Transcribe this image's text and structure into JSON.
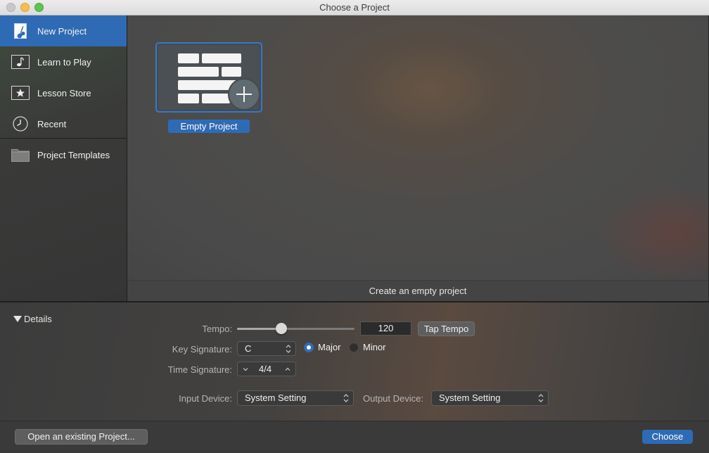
{
  "window": {
    "title": "Choose a Project"
  },
  "sidebar": {
    "items": [
      {
        "label": "New Project",
        "icon": "guitar-document-icon",
        "active": true
      },
      {
        "label": "Learn to Play",
        "icon": "music-note-icon",
        "active": false
      },
      {
        "label": "Lesson Store",
        "icon": "star-icon",
        "active": false
      },
      {
        "label": "Recent",
        "icon": "clock-icon",
        "active": false
      },
      {
        "label": "Project Templates",
        "icon": "folder-icon",
        "active": false
      }
    ]
  },
  "main": {
    "tile_label": "Empty Project",
    "tile_icon": "bricks-plus-icon",
    "description": "Create an empty project"
  },
  "details": {
    "toggle_label": "Details",
    "tempo": {
      "label": "Tempo:",
      "value": "120",
      "slider_fraction": 0.38,
      "tap_label": "Tap Tempo"
    },
    "key_signature": {
      "label": "Key Signature:",
      "value": "C",
      "major_label": "Major",
      "minor_label": "Minor",
      "selected": "Major"
    },
    "time_signature": {
      "label": "Time Signature:",
      "value": "4/4"
    },
    "input_device": {
      "label": "Input Device:",
      "value": "System Setting"
    },
    "output_device": {
      "label": "Output Device:",
      "value": "System Setting"
    }
  },
  "footer": {
    "open_label": "Open an existing Project...",
    "choose_label": "Choose"
  },
  "colors": {
    "accent": "#2f6bb5"
  }
}
